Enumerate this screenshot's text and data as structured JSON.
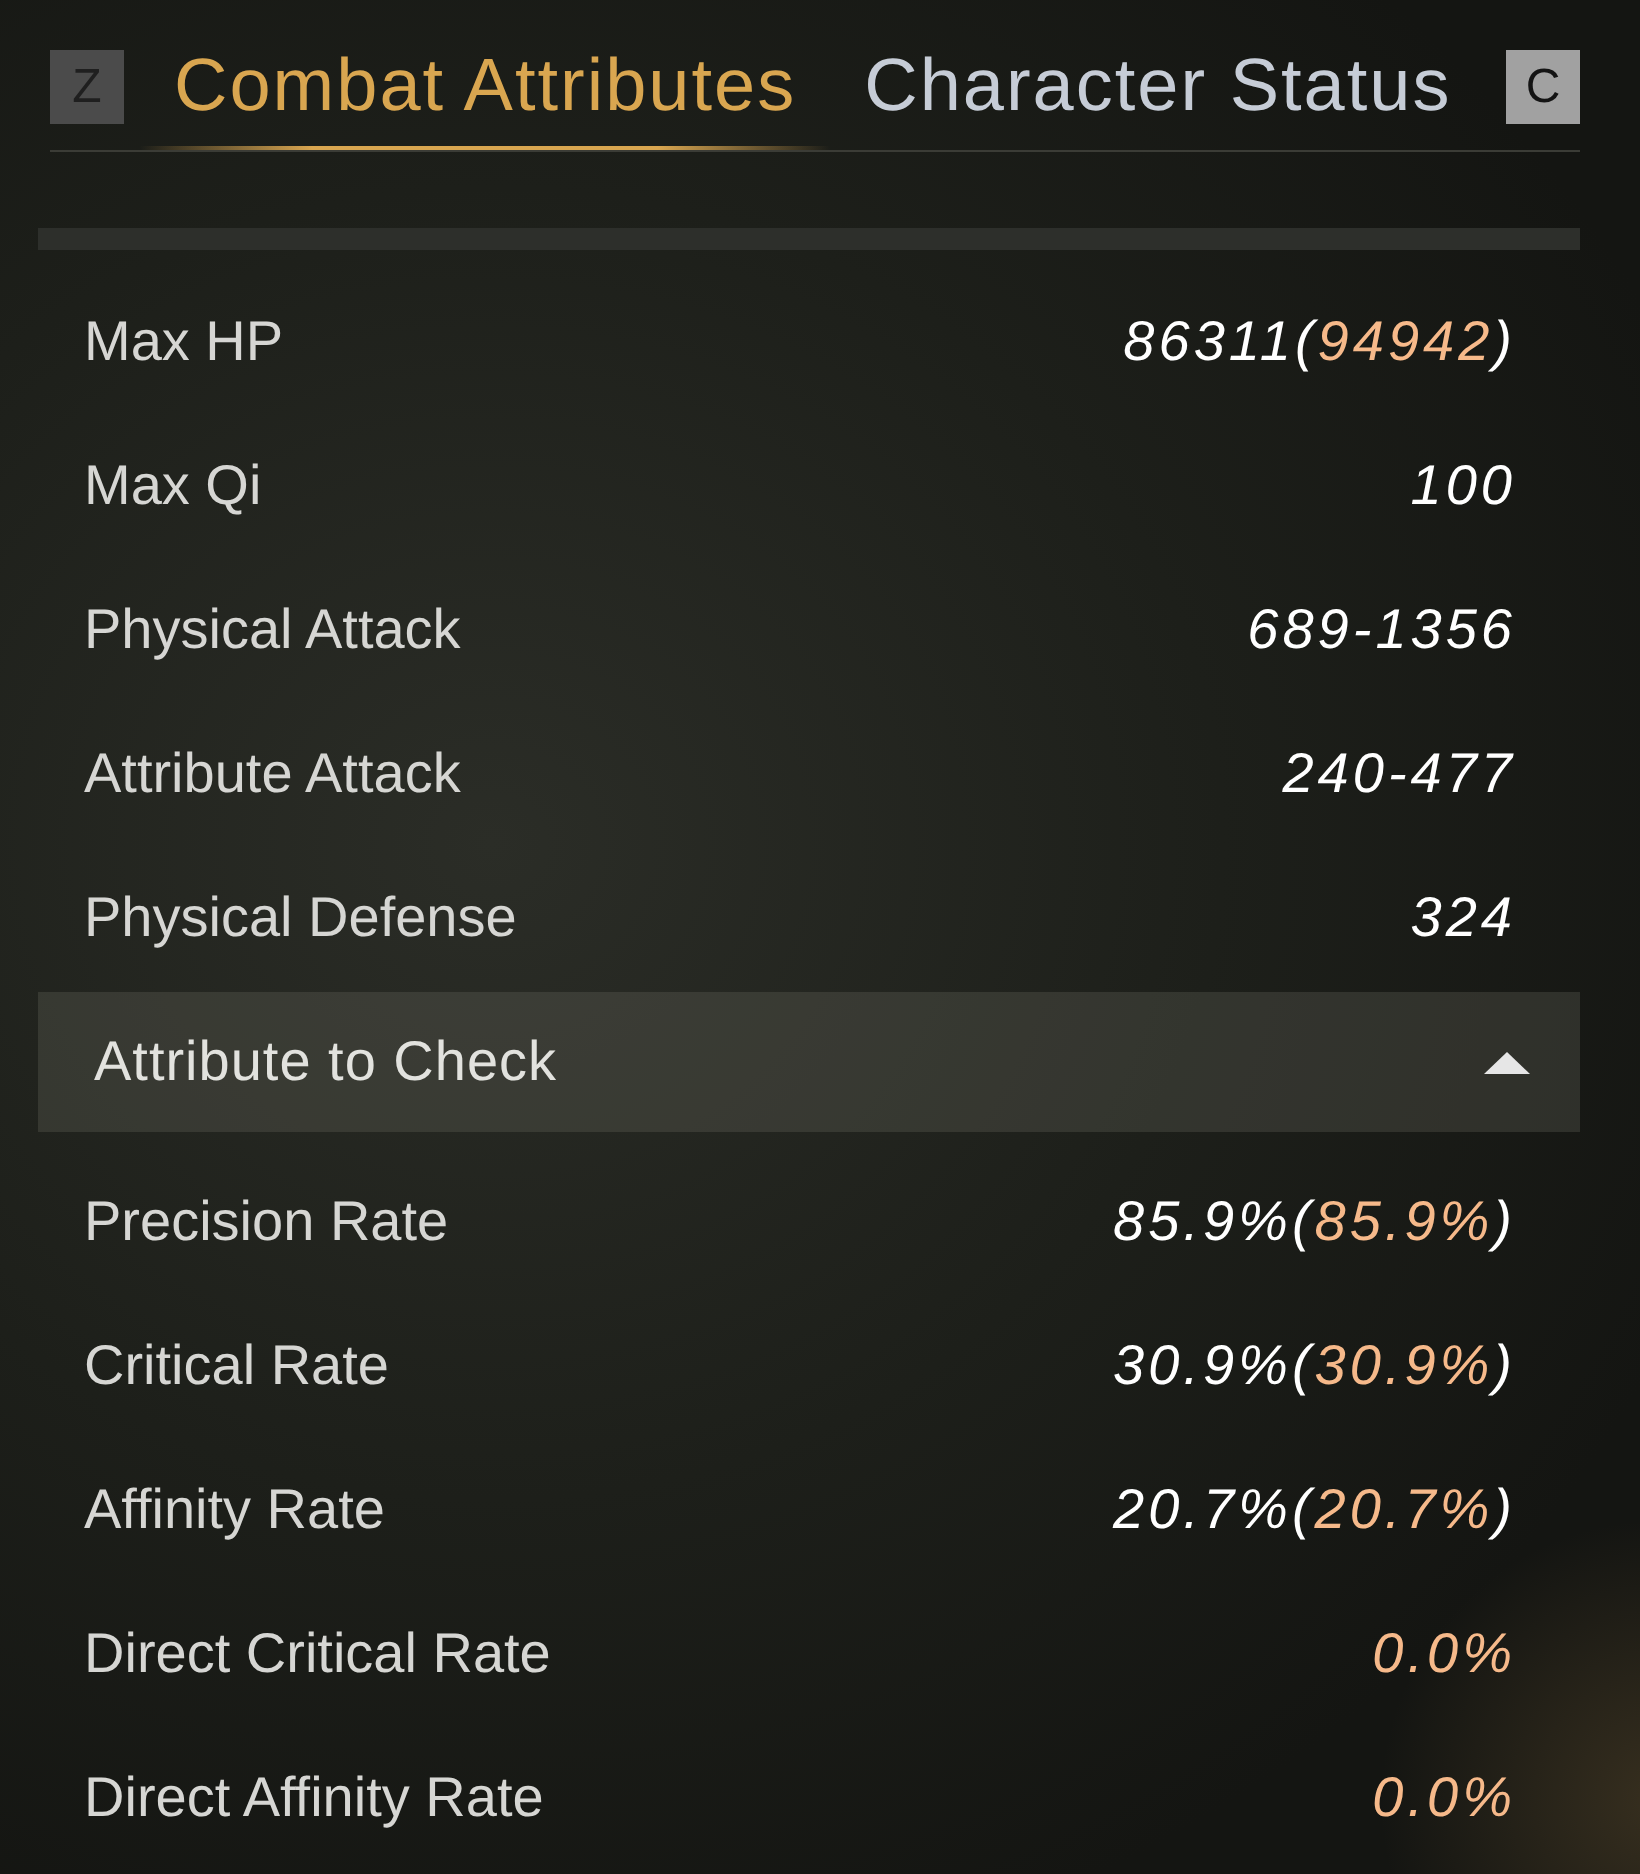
{
  "tabs": {
    "prev_key": {
      "label": "Z",
      "disabled": true
    },
    "items": [
      {
        "label": "Combat Attributes",
        "selected": true
      },
      {
        "label": "Character Status",
        "selected": false
      }
    ],
    "next_key": {
      "label": "C",
      "disabled": false
    }
  },
  "stats": [
    {
      "label": "Max HP",
      "value": [
        {
          "text": "86311",
          "highlight": false
        },
        {
          "text": "(",
          "highlight": false
        },
        {
          "text": "94942",
          "highlight": true
        },
        {
          "text": ")",
          "highlight": false
        }
      ]
    },
    {
      "label": "Max Qi",
      "value": [
        {
          "text": "100",
          "highlight": false
        }
      ]
    },
    {
      "label": "Physical Attack",
      "value": [
        {
          "text": "689-1356",
          "highlight": false
        }
      ]
    },
    {
      "label": "Attribute Attack",
      "value": [
        {
          "text": "240-477",
          "highlight": false
        }
      ]
    },
    {
      "label": "Physical Defense",
      "value": [
        {
          "text": "324",
          "highlight": false
        }
      ]
    }
  ],
  "section": {
    "title": "Attribute to Check",
    "expanded": true,
    "stats": [
      {
        "label": "Precision Rate",
        "value": [
          {
            "text": "85.9%",
            "highlight": false
          },
          {
            "text": "(",
            "highlight": false
          },
          {
            "text": "85.9%",
            "highlight": true
          },
          {
            "text": ")",
            "highlight": false
          }
        ]
      },
      {
        "label": "Critical Rate",
        "value": [
          {
            "text": "30.9%",
            "highlight": false
          },
          {
            "text": "(",
            "highlight": false
          },
          {
            "text": "30.9%",
            "highlight": true
          },
          {
            "text": ")",
            "highlight": false
          }
        ]
      },
      {
        "label": "Affinity Rate",
        "value": [
          {
            "text": "20.7%",
            "highlight": false
          },
          {
            "text": "(",
            "highlight": false
          },
          {
            "text": "20.7%",
            "highlight": true
          },
          {
            "text": ")",
            "highlight": false
          }
        ]
      },
      {
        "label": "Direct Critical Rate",
        "value": [
          {
            "text": "0.0%",
            "highlight": true
          }
        ]
      },
      {
        "label": "Direct Affinity Rate",
        "value": [
          {
            "text": "0.0%",
            "highlight": true
          }
        ]
      }
    ]
  }
}
